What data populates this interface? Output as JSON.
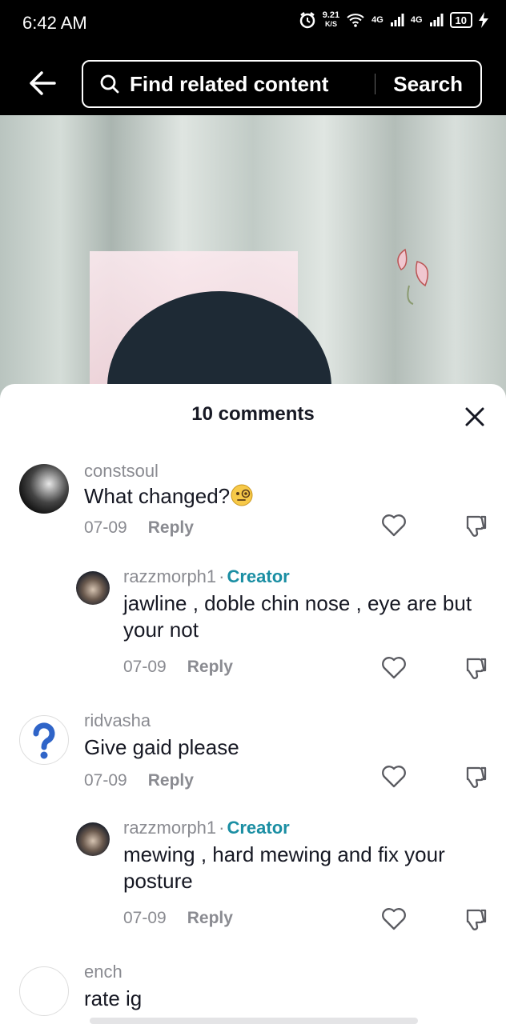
{
  "status": {
    "time": "6:42 AM",
    "speed": "9.21",
    "speed_unit": "K/S",
    "net1": "4G",
    "net2": "4G",
    "battery": "10"
  },
  "search": {
    "placeholder": "Find related content",
    "button": "Search"
  },
  "sheet": {
    "title": "10 comments"
  },
  "comments": [
    {
      "user": "constsoul",
      "text": "What changed?",
      "emoji": "face-with-monocle-icon",
      "date": "07-09",
      "reply": "Reply"
    },
    {
      "user": "razzmorph1",
      "sep": "·",
      "badge": "Creator",
      "text": "jawline , doble chin nose , eye are but your not",
      "date": "07-09",
      "reply": "Reply"
    },
    {
      "user": "ridvasha",
      "text": "Give gaid please",
      "date": "07-09",
      "reply": "Reply"
    },
    {
      "user": "razzmorph1",
      "sep": "·",
      "badge": "Creator",
      "text": "mewing , hard mewing and fix your posture",
      "date": "07-09",
      "reply": "Reply"
    },
    {
      "user": "ench",
      "text": "rate ig"
    }
  ],
  "colors": {
    "creator": "#1a8ea3",
    "muted": "#8a8b91",
    "text": "#161823"
  }
}
